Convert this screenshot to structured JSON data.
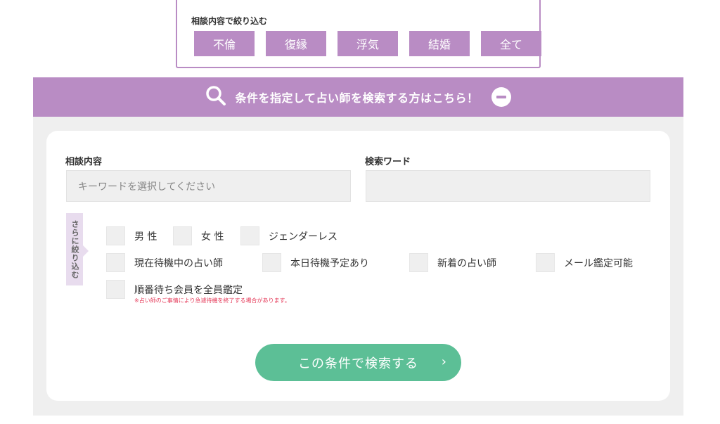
{
  "filter": {
    "title": "相談内容で絞り込む",
    "tags": [
      "不倫",
      "復縁",
      "浮気",
      "結婚",
      "全て"
    ]
  },
  "band": {
    "text": "条件を指定して占い師を検索する方はこちら！"
  },
  "form": {
    "consult_label": "相談内容",
    "consult_placeholder": "キーワードを選択してください",
    "keyword_label": "検索ワード",
    "keyword_value": ""
  },
  "refine": {
    "side_label": "さらに絞り込む",
    "gender": [
      "男 性",
      "女 性",
      "ジェンダーレス"
    ],
    "options": [
      "現在待機中の占い師",
      "本日待機予定あり",
      "新着の占い師",
      "メール鑑定可能"
    ],
    "order": "順番待ち会員を全員鑑定",
    "note": "※占い師のご事情により急遽待機を終了する場合があります。"
  },
  "search_button": {
    "label": "この条件で検索する",
    "arrow": "›"
  },
  "colors": {
    "accent": "#b98cc4",
    "button": "#5cbf96",
    "note": "#e53b5a"
  }
}
